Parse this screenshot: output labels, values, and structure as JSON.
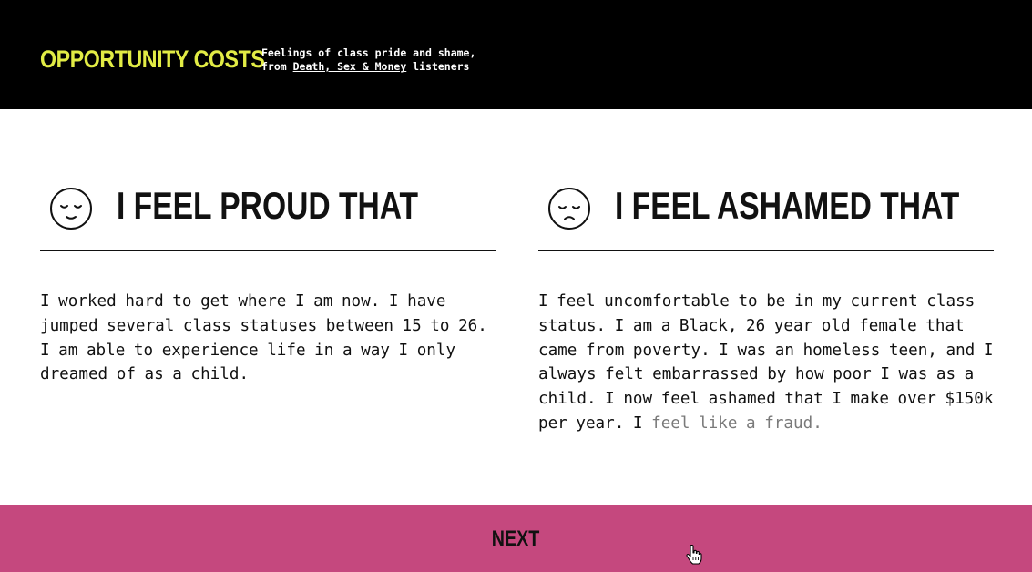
{
  "header": {
    "brand": "OPPORTUNITY COSTS",
    "tagline_line1": "Feelings of class pride and shame,",
    "tagline_prefix": "from ",
    "tagline_link": "Death, Sex & Money",
    "tagline_suffix": " listeners"
  },
  "columns": [
    {
      "icon": "smiling-face-icon",
      "title": "I FEEL PROUD THAT",
      "body": "I worked hard to get where I am now. I have jumped several class statuses between 15 to 26. I am able to experience life in a way I only dreamed of as a child."
    },
    {
      "icon": "sad-face-icon",
      "title": "I FEEL ASHAMED THAT",
      "body": "I feel uncomfortable to be in my current class status. I am a Black, 26 year old female that came from poverty. I was an homeless teen, and I always felt embarrassed by how poor I was as a child. I now feel ashamed that I make over $150k per year. I",
      "body_faded": "feel like a fraud."
    }
  ],
  "next_button": {
    "label": "NEXT"
  },
  "colors": {
    "header_bg": "#000000",
    "brand": "#e2ec45",
    "next_bg": "#c5487e",
    "text": "#111111"
  }
}
